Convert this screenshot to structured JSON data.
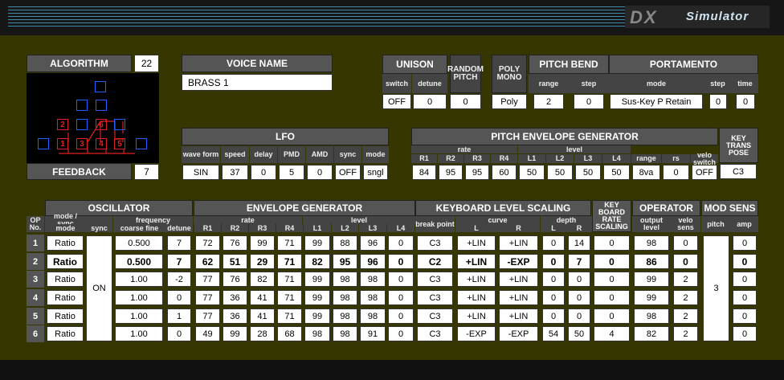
{
  "app": {
    "logo_dx": "DX",
    "logo_text": "Simulator"
  },
  "algorithm": {
    "label": "ALGORITHM",
    "value": "22",
    "feedback_label": "FEEDBACK",
    "feedback_value": "7",
    "operators": [
      "1",
      "2",
      "3",
      "4",
      "5",
      "6"
    ]
  },
  "voice": {
    "label": "VOICE NAME",
    "name": "BRASS  1"
  },
  "unison": {
    "label": "UNISON",
    "switch_label": "switch",
    "detune_label": "detune",
    "switch": "OFF",
    "detune": "0"
  },
  "random_pitch": {
    "label": "RANDOM PITCH",
    "value": "0"
  },
  "poly_mono": {
    "label": "POLY MONO",
    "value": "Poly"
  },
  "pitch_bend": {
    "label": "PITCH BEND",
    "range_label": "range",
    "step_label": "step",
    "range": "2",
    "step": "0"
  },
  "portamento": {
    "label": "PORTAMENTO",
    "mode_label": "mode",
    "step_label": "step",
    "time_label": "time",
    "mode": "Sus-Key P Retain",
    "step": "0",
    "time": "0"
  },
  "lfo": {
    "label": "LFO",
    "headers": [
      "wave form",
      "speed",
      "delay",
      "PMD",
      "AMD",
      "sync",
      "mode"
    ],
    "values": [
      "SIN",
      "37",
      "0",
      "5",
      "0",
      "OFF",
      "sngl"
    ]
  },
  "peg": {
    "label": "PITCH ENVELOPE GENERATOR",
    "rate_label": "rate",
    "level_label": "level",
    "headers": [
      "R1",
      "R2",
      "R3",
      "R4",
      "L1",
      "L2",
      "L3",
      "L4",
      "range",
      "rs",
      "velo switch"
    ],
    "values": [
      "84",
      "95",
      "95",
      "60",
      "50",
      "50",
      "50",
      "50",
      "8va",
      "0",
      "OFF"
    ]
  },
  "transpose": {
    "label": "KEY TRANS POSE",
    "value": "C3"
  },
  "table": {
    "oscillator_label": "OSCILLATOR",
    "eg_label": "ENVELOPE GENERATOR",
    "kls_label": "KEYBOARD LEVEL SCALING",
    "krs_label": "KEY BOARD RATE SCALING",
    "operator_label": "OPERATOR",
    "modsens_label": "MOD SENS",
    "op_label": "OP No.",
    "mode_sync_label": "mode / sync",
    "mode_label": "mode",
    "sync_label": "sync",
    "frequency_label": "frequency",
    "coarse_fine_label": "coarse fine",
    "detune_label": "detune",
    "rate_label": "rate",
    "level_label": "level",
    "eg_headers": [
      "R1",
      "R2",
      "R3",
      "R4",
      "L1",
      "L2",
      "L3",
      "L4"
    ],
    "break_point_label": "break point",
    "curve_label": "curve",
    "depth_label": "depth",
    "l_label": "L",
    "r_label": "R",
    "krs_sub_label": "RATE SCALING",
    "output_level_label": "output level",
    "velo_sens_label": "velo sens",
    "pitch_label": "pitch",
    "amp_label": "amp",
    "sync_value": "ON",
    "pitch_value": "3",
    "rows": [
      {
        "op": "1",
        "mode": "Ratio",
        "freq": "0.500",
        "detune": "7",
        "r": [
          "72",
          "76",
          "99",
          "71"
        ],
        "l": [
          "99",
          "88",
          "96",
          "0"
        ],
        "bp": "C3",
        "cl": "+LIN",
        "cr": "+LIN",
        "dl": "0",
        "dr": "14",
        "krs": "0",
        "out": "98",
        "velo": "0",
        "amp": "0"
      },
      {
        "op": "2",
        "mode": "Ratio",
        "freq": "0.500",
        "detune": "7",
        "r": [
          "62",
          "51",
          "29",
          "71"
        ],
        "l": [
          "82",
          "95",
          "96",
          "0"
        ],
        "bp": "C2",
        "cl": "+LIN",
        "cr": "-EXP",
        "dl": "0",
        "dr": "7",
        "krs": "0",
        "out": "86",
        "velo": "0",
        "amp": "0"
      },
      {
        "op": "3",
        "mode": "Ratio",
        "freq": "1.00",
        "detune": "-2",
        "r": [
          "77",
          "76",
          "82",
          "71"
        ],
        "l": [
          "99",
          "98",
          "98",
          "0"
        ],
        "bp": "C3",
        "cl": "+LIN",
        "cr": "+LIN",
        "dl": "0",
        "dr": "0",
        "krs": "0",
        "out": "99",
        "velo": "2",
        "amp": "0"
      },
      {
        "op": "4",
        "mode": "Ratio",
        "freq": "1.00",
        "detune": "0",
        "r": [
          "77",
          "36",
          "41",
          "71"
        ],
        "l": [
          "99",
          "98",
          "98",
          "0"
        ],
        "bp": "C3",
        "cl": "+LIN",
        "cr": "+LIN",
        "dl": "0",
        "dr": "0",
        "krs": "0",
        "out": "99",
        "velo": "2",
        "amp": "0"
      },
      {
        "op": "5",
        "mode": "Ratio",
        "freq": "1.00",
        "detune": "1",
        "r": [
          "77",
          "36",
          "41",
          "71"
        ],
        "l": [
          "99",
          "98",
          "98",
          "0"
        ],
        "bp": "C3",
        "cl": "+LIN",
        "cr": "+LIN",
        "dl": "0",
        "dr": "0",
        "krs": "0",
        "out": "98",
        "velo": "2",
        "amp": "0"
      },
      {
        "op": "6",
        "mode": "Ratio",
        "freq": "1.00",
        "detune": "0",
        "r": [
          "49",
          "99",
          "28",
          "68"
        ],
        "l": [
          "98",
          "98",
          "91",
          "0"
        ],
        "bp": "C3",
        "cl": "-EXP",
        "cr": "-EXP",
        "dl": "54",
        "dr": "50",
        "krs": "4",
        "out": "82",
        "velo": "2",
        "amp": "0"
      }
    ]
  },
  "colors": {
    "background": "#363600",
    "header": "#555555",
    "algorithm_blue": "#2060ff",
    "algorithm_red": "#e02020"
  }
}
